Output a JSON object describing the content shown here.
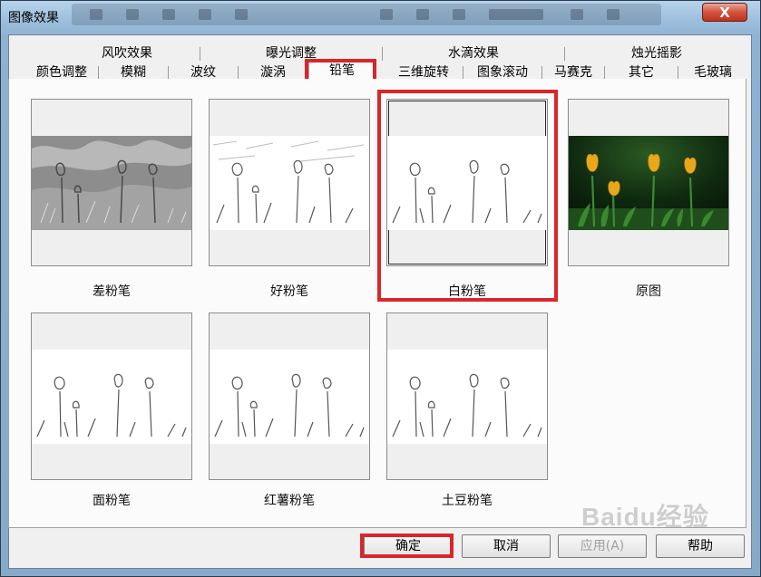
{
  "window": {
    "title": "图像效果",
    "close_glyph": "X"
  },
  "tabs_top": [
    {
      "label": "风吹效果"
    },
    {
      "label": "曝光调整"
    },
    {
      "label": "水滴效果"
    },
    {
      "label": "烛光摇影"
    }
  ],
  "tabs_bottom": [
    {
      "label": "颜色调整"
    },
    {
      "label": "模糊"
    },
    {
      "label": "波纹"
    },
    {
      "label": "漩涡"
    },
    {
      "label": "铅笔",
      "selected": true
    },
    {
      "label": "三维旋转"
    },
    {
      "label": "图象滚动"
    },
    {
      "label": "马赛克"
    },
    {
      "label": "其它"
    },
    {
      "label": "毛玻璃"
    }
  ],
  "effects": [
    {
      "label": "差粉笔",
      "style": "emboss"
    },
    {
      "label": "好粉笔",
      "style": "light"
    },
    {
      "label": "白粉笔",
      "style": "outline",
      "selected": true
    },
    {
      "label": "原图",
      "style": "original"
    },
    {
      "label": "面粉笔",
      "style": "outline"
    },
    {
      "label": "红薯粉笔",
      "style": "outline"
    },
    {
      "label": "土豆粉笔",
      "style": "outline"
    }
  ],
  "buttons": {
    "ok": "确定",
    "cancel": "取消",
    "apply": "应用(A)",
    "help": "帮助"
  },
  "watermark": "Baidu经验",
  "colors": {
    "highlight": "#d9262b",
    "tulip": "#e8a81c",
    "leaf": "#2f7a2a"
  }
}
